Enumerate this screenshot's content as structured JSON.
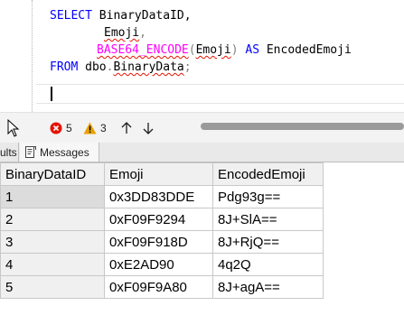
{
  "editor": {
    "line1": {
      "kw": "SELECT",
      "rest": " BinaryDataID,"
    },
    "line2": {
      "text": "Emoji"
    },
    "line2_comma": ",",
    "line3": {
      "fn": "BASE64_ENCODE",
      "open": "(",
      "arg": "Emoji",
      "close": ")",
      "as": "AS",
      "alias": " EncodedEmoji"
    },
    "line4": {
      "kw": "FROM",
      "schema": "dbo",
      "dot": ".",
      "table": "BinaryData",
      "semi": ";"
    }
  },
  "statusbar": {
    "errors": "5",
    "warnings": "3",
    "error_color": "#e51400",
    "warning_color": "#e8a200"
  },
  "tabs": {
    "results_label": "ults",
    "messages_label": "Messages"
  },
  "grid": {
    "columns": [
      "BinaryDataID",
      "Emoji",
      "EncodedEmoji"
    ],
    "rows": [
      [
        "1",
        "0x3DD83DDE",
        "Pdg93g=="
      ],
      [
        "2",
        "0xF09F9294",
        "8J+SlA=="
      ],
      [
        "3",
        "0xF09F918D",
        "8J+RjQ=="
      ],
      [
        "4",
        "0xE2AD90",
        "4q2Q"
      ],
      [
        "5",
        "0xF09F9A80",
        "8J+agA=="
      ]
    ]
  }
}
